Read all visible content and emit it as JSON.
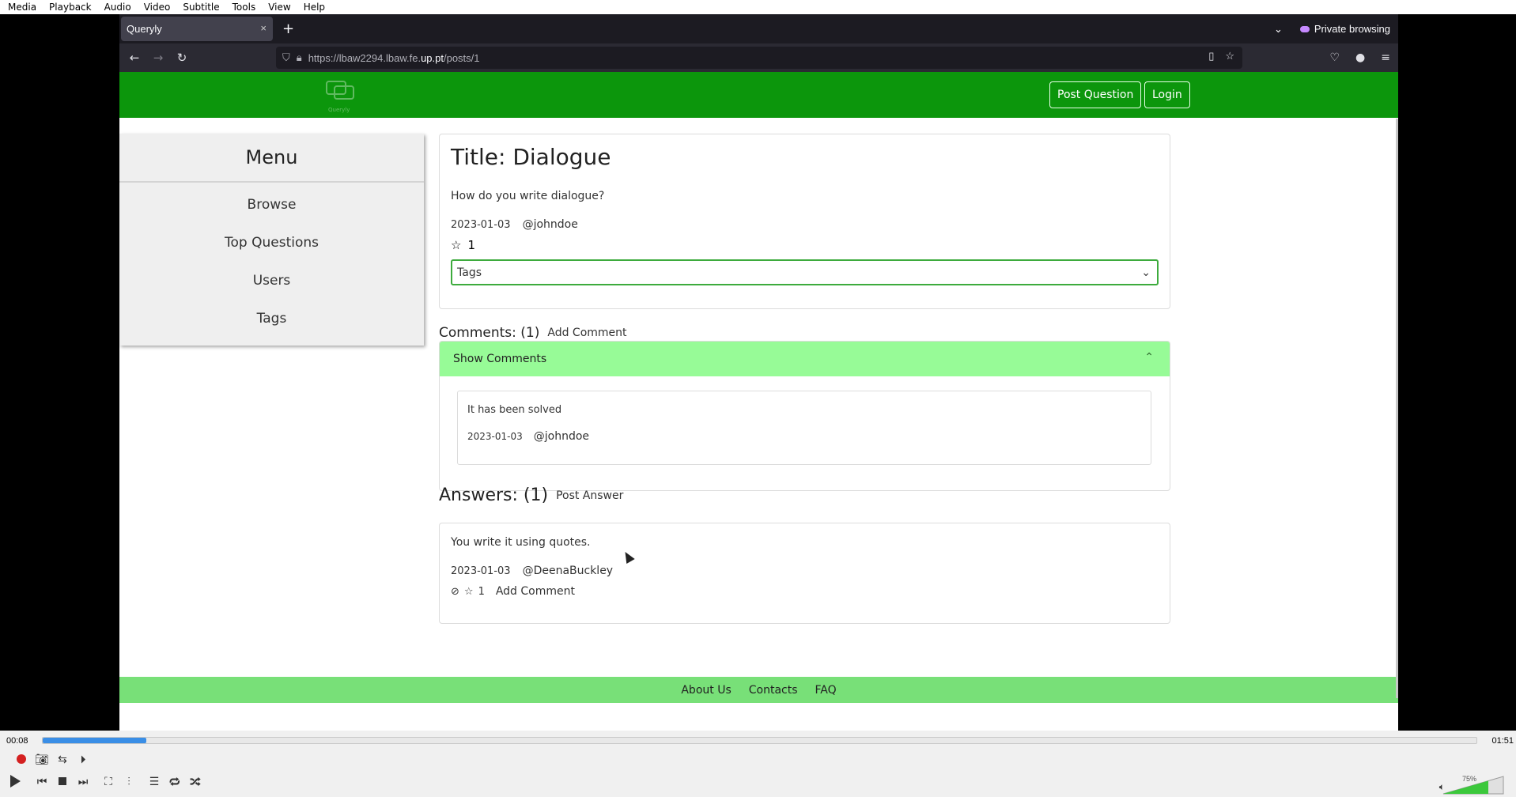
{
  "vlc": {
    "menu": [
      "Media",
      "Playback",
      "Audio",
      "Video",
      "Subtitle",
      "Tools",
      "View",
      "Help"
    ],
    "time_elapsed": "00:08",
    "time_total": "01:51",
    "progress": 0.072,
    "volume_label": "75%",
    "volume": 0.75
  },
  "browser": {
    "tab_title": "Queryly",
    "tab_close": "×",
    "new_tab": "+",
    "private_label": "Private browsing",
    "url_prefix": "https://lbaw2294.lbaw.fe.",
    "url_domain": "up.pt",
    "url_path": "/posts/1"
  },
  "site": {
    "logo_label": "Queryly",
    "post_question_label": "Post Question",
    "login_label": "Login"
  },
  "menu": {
    "title": "Menu",
    "items": [
      "Browse",
      "Top Questions",
      "Users",
      "Tags"
    ]
  },
  "post": {
    "title": "Title: Dialogue",
    "body": "How do you write dialogue?",
    "date": "2023-01-03",
    "author": "@johndoe",
    "stars": "1",
    "tags_placeholder": "Tags"
  },
  "comments": {
    "heading": "Comments: (1)",
    "add_label": "Add Comment",
    "toggle_label": "Show Comments",
    "items": [
      {
        "text": "It has been solved",
        "date": "2023-01-03",
        "author": "@johndoe"
      }
    ]
  },
  "answers": {
    "heading": "Answers: (1)",
    "post_label": "Post Answer",
    "items": [
      {
        "text": "You write it using quotes.",
        "date": "2023-01-03",
        "author": "@DeenaBuckley",
        "stars": "1",
        "add_comment": "Add Comment"
      }
    ]
  },
  "footer": {
    "links": [
      "About Us",
      "Contacts",
      "FAQ"
    ]
  }
}
